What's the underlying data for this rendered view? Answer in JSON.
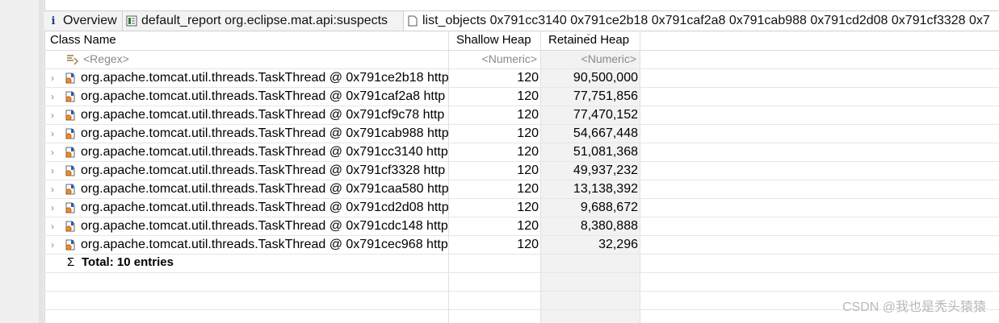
{
  "tabs": [
    {
      "icon": "info-icon",
      "label": "Overview"
    },
    {
      "icon": "report-icon",
      "label": "default_report  org.eclipse.mat.api:suspects"
    },
    {
      "icon": "document-icon",
      "label": "list_objects  0x791cc3140 0x791ce2b18 0x791caf2a8 0x791cab988 0x791cd2d08 0x791cf3328 0x7"
    }
  ],
  "table": {
    "columns": {
      "class_name": "Class Name",
      "shallow_heap": "Shallow Heap",
      "retained_heap": "Retained Heap"
    },
    "filters": {
      "class_name": "<Regex>",
      "shallow_heap": "<Numeric>",
      "retained_heap": "<Numeric>"
    },
    "rows": [
      {
        "name": "org.apache.tomcat.util.threads.TaskThread @ 0x791ce2b18  http",
        "shallow": "120",
        "retained": "90,500,000"
      },
      {
        "name": "org.apache.tomcat.util.threads.TaskThread @ 0x791caf2a8  http",
        "shallow": "120",
        "retained": "77,751,856"
      },
      {
        "name": "org.apache.tomcat.util.threads.TaskThread @ 0x791cf9c78  http",
        "shallow": "120",
        "retained": "77,470,152"
      },
      {
        "name": "org.apache.tomcat.util.threads.TaskThread @ 0x791cab988  http",
        "shallow": "120",
        "retained": "54,667,448"
      },
      {
        "name": "org.apache.tomcat.util.threads.TaskThread @ 0x791cc3140  http",
        "shallow": "120",
        "retained": "51,081,368"
      },
      {
        "name": "org.apache.tomcat.util.threads.TaskThread @ 0x791cf3328  http",
        "shallow": "120",
        "retained": "49,937,232"
      },
      {
        "name": "org.apache.tomcat.util.threads.TaskThread @ 0x791caa580  http",
        "shallow": "120",
        "retained": "13,138,392"
      },
      {
        "name": "org.apache.tomcat.util.threads.TaskThread @ 0x791cd2d08  http",
        "shallow": "120",
        "retained": "9,688,672"
      },
      {
        "name": "org.apache.tomcat.util.threads.TaskThread @ 0x791cdc148  http",
        "shallow": "120",
        "retained": "8,380,888"
      },
      {
        "name": "org.apache.tomcat.util.threads.TaskThread @ 0x791cec968  http",
        "shallow": "120",
        "retained": "32,296"
      }
    ],
    "total_label": "Total: 10 entries"
  },
  "watermark": "CSDN @我也是秃头猿猿",
  "colors": {
    "retained_column_bg": "#f2f2f2",
    "grid_line": "#e6e6e6"
  }
}
